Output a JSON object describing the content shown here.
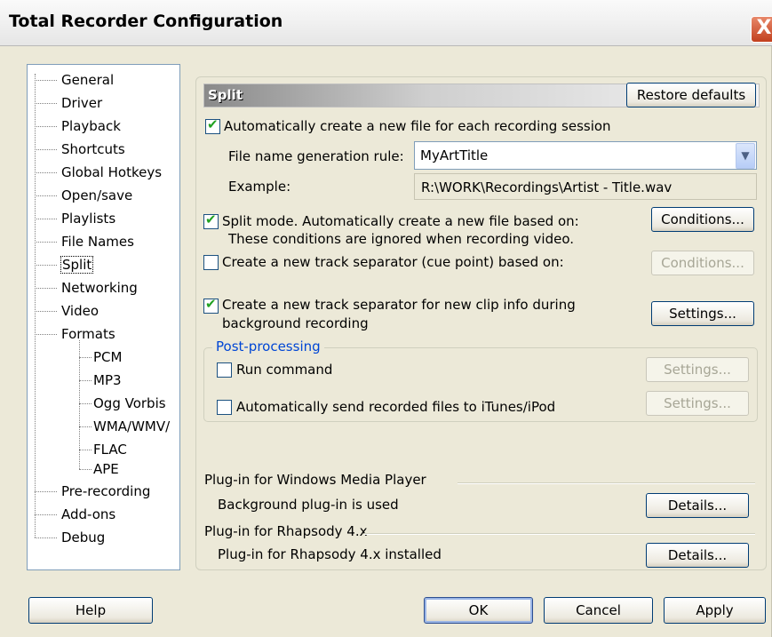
{
  "window": {
    "title": "Total Recorder Configuration",
    "close_glyph": "X"
  },
  "tree": {
    "items": [
      {
        "label": "General"
      },
      {
        "label": "Driver"
      },
      {
        "label": "Playback"
      },
      {
        "label": "Shortcuts"
      },
      {
        "label": "Global Hotkeys"
      },
      {
        "label": "Open/save"
      },
      {
        "label": "Playlists"
      },
      {
        "label": "File Names"
      },
      {
        "label": "Split"
      },
      {
        "label": "Networking"
      },
      {
        "label": "Video"
      },
      {
        "label": "Formats"
      },
      {
        "label": "PCM"
      },
      {
        "label": "MP3"
      },
      {
        "label": "Ogg Vorbis"
      },
      {
        "label": "WMA/WMV/"
      },
      {
        "label": "FLAC"
      },
      {
        "label": "APE"
      },
      {
        "label": "Pre-recording"
      },
      {
        "label": "Add-ons"
      },
      {
        "label": "Debug"
      }
    ],
    "selected": "Split"
  },
  "split": {
    "header": "Split",
    "restore_defaults": "Restore defaults",
    "auto_create_label": "Automatically create a new file for each recording session",
    "auto_create_checked": true,
    "name_rule_label": "File name generation rule:",
    "name_rule_value": "MyArtTitle",
    "example_label": "Example:",
    "example_value": "R:\\WORK\\Recordings\\Artist - Title.wav",
    "split_mode_label": "Split mode. Automatically create a new file based on:",
    "split_mode_note": "These conditions are ignored when recording video.",
    "split_mode_checked": true,
    "conditions_button": "Conditions...",
    "cue_label": "Create a new track separator (cue point) based on:",
    "cue_checked": false,
    "cue_conditions_button": "Conditions...",
    "clip_info_label_1": "Create a new track separator for new clip info during",
    "clip_info_label_2": "background recording",
    "clip_info_checked": true,
    "clip_settings_button": "Settings..."
  },
  "post_processing": {
    "title": "Post-processing",
    "run_command_label": "Run command",
    "run_command_checked": false,
    "run_settings_button": "Settings...",
    "itunes_label": "Automatically send recorded files to iTunes/iPod",
    "itunes_checked": false,
    "itunes_settings_button": "Settings..."
  },
  "plugins": {
    "wmp_title": "Plug-in for Windows Media Player",
    "wmp_status": "Background plug-in is used",
    "wmp_details": "Details...",
    "rhap_title": "Plug-in for Rhapsody 4.x",
    "rhap_status": "Plug-in for Rhapsody 4.x installed",
    "rhap_details": "Details..."
  },
  "footer": {
    "help": "Help",
    "ok": "OK",
    "cancel": "Cancel",
    "apply": "Apply"
  },
  "icons": {
    "check": "✔",
    "dropdown": "▼"
  }
}
